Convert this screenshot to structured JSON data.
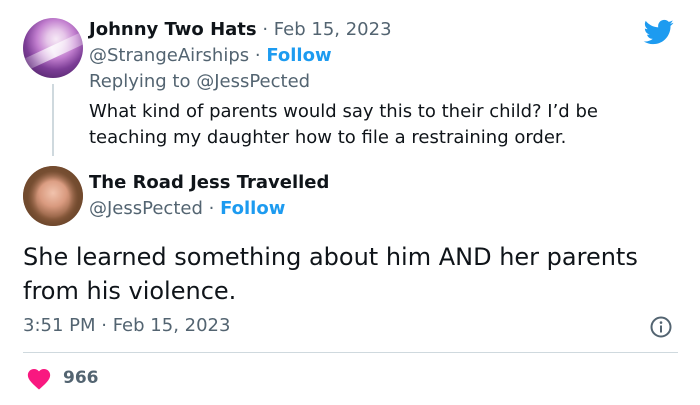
{
  "reply_tweet": {
    "author_name": "Johnny Two Hats",
    "separator": " · ",
    "date": "Feb 15, 2023",
    "handle": "@StrangeAirships",
    "handle_separator": " · ",
    "follow_label": "Follow",
    "replying_prefix": "Replying to ",
    "replying_handle": "@JessPected",
    "text": "What kind of parents would say this to their child? I’d be teaching my daughter how to file a restraining order."
  },
  "main_tweet": {
    "author_name": "The Road Jess Travelled",
    "handle": "@JessPected",
    "handle_separator": " · ",
    "follow_label": "Follow",
    "text": "She learned something about him AND her parents from his violence.",
    "timestamp": "3:51 PM · Feb 15, 2023",
    "like_count": "966"
  },
  "icons": {
    "brand": "twitter-bird-icon",
    "info": "info-icon",
    "like": "heart-icon"
  },
  "colors": {
    "accent": "#1d9bf0",
    "secondary_text": "#536471",
    "primary_text": "#0f1419",
    "heart": "#f91880",
    "divider": "#cfd9de"
  }
}
